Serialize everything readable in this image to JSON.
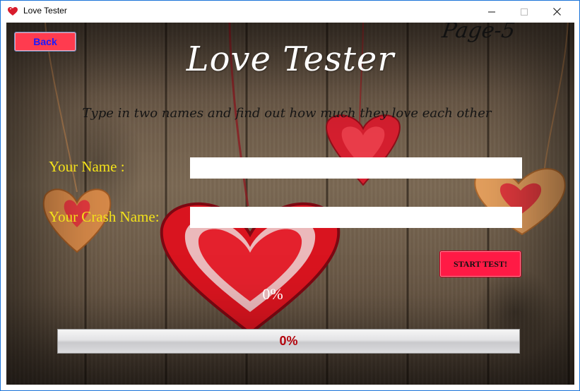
{
  "window": {
    "title": "Love Tester",
    "app_icon": "heart-icon",
    "controls": [
      "minimize-icon",
      "maximize-icon",
      "close-icon"
    ]
  },
  "header": {
    "back_label": "Back",
    "page_label": "Page-5",
    "title": "Love Tester",
    "subtitle": "Type in two names and find out how much they love each other"
  },
  "form": {
    "your_name_label": "Your Name :",
    "your_name_value": "",
    "crash_name_label": "Your Crash Name:",
    "crash_name_value": "",
    "start_label": "START TEST!"
  },
  "result": {
    "percent_text": "0%",
    "progress_value": 0,
    "progress_text": "0%"
  },
  "colors": {
    "back_button": "#ff3b4f",
    "back_text": "#1a1aff",
    "start_button": "#ff1a45",
    "label_color": "#f3e21a",
    "progress_text": "#b3050d"
  }
}
